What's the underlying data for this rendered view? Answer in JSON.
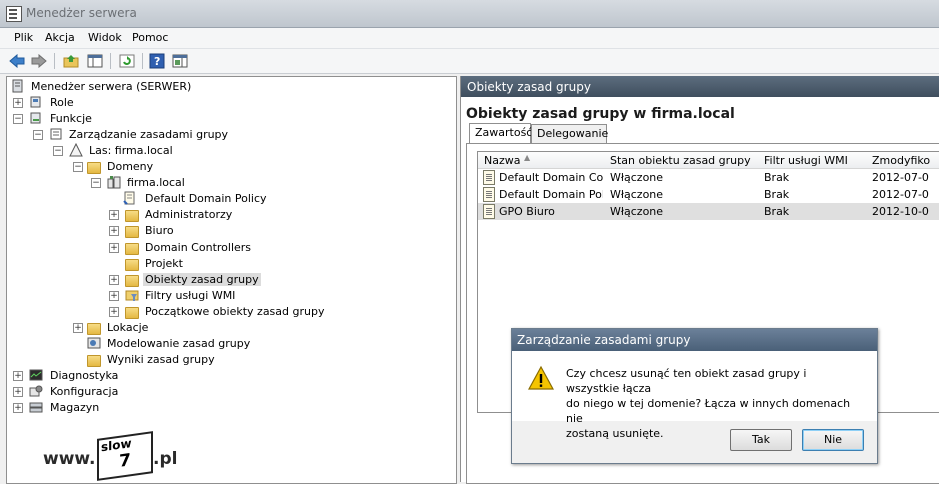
{
  "window": {
    "title": "Menedżer serwera"
  },
  "menu": [
    "Plik",
    "Akcja",
    "Widok",
    "Pomoc"
  ],
  "toolbar": {
    "icons": [
      "back-arrow-icon",
      "forward-arrow-icon",
      "up-folder-icon",
      "show-hide-tree-icon",
      "refresh-icon",
      "help-icon",
      "action-pane-icon"
    ]
  },
  "tree": {
    "root": "Menedżer serwera (SERWER)",
    "role": "Role",
    "funkcje": "Funkcje",
    "gpm": "Zarządzanie zasadami grupy",
    "forest": "Las: firma.local",
    "domeny": "Domeny",
    "domain": "firma.local",
    "items": [
      "Default Domain Policy",
      "Administratorzy",
      "Biuro",
      "Domain Controllers",
      "Projekt",
      "Obiekty zasad grupy",
      "Filtry usługi WMI",
      "Początkowe obiekty zasad grupy"
    ],
    "lokacje": "Lokacje",
    "modelowanie": "Modelowanie zasad grupy",
    "wyniki": "Wyniki zasad grupy",
    "diagnostyka": "Diagnostyka",
    "konfiguracja": "Konfiguracja",
    "magazyn": "Magazyn"
  },
  "logo": {
    "prefix": "www.",
    "top": "slow",
    "number": "7",
    "suffix": ".pl"
  },
  "right_pane": {
    "header": "Obiekty zasad grupy",
    "title": "Obiekty zasad grupy w firma.local",
    "tabs": [
      "Zawartość",
      "Delegowanie"
    ],
    "columns": [
      "Nazwa",
      "Stan obiektu zasad grupy",
      "Filtr usługi WMI",
      "Zmodyfiko"
    ],
    "rows": [
      [
        "Default Domain Co...",
        "Włączone",
        "Brak",
        "2012-07-0"
      ],
      [
        "Default Domain Poli...",
        "Włączone",
        "Brak",
        "2012-07-0"
      ],
      [
        "GPO Biuro",
        "Włączone",
        "Brak",
        "2012-10-0"
      ]
    ]
  },
  "dialog": {
    "title": "Zarządzanie zasadami grupy",
    "message": "Czy chcesz usunąć ten obiekt zasad grupy i wszystkie łącza\ndo niego w tej domenie? Łącza w innych domenach nie\nzostaną usunięte.",
    "yes": "Tak",
    "no": "Nie"
  },
  "colors": {
    "header_bg": "#4b5b6b",
    "dialog_title": "#5a6f88",
    "selection": "#dcdcdc"
  }
}
